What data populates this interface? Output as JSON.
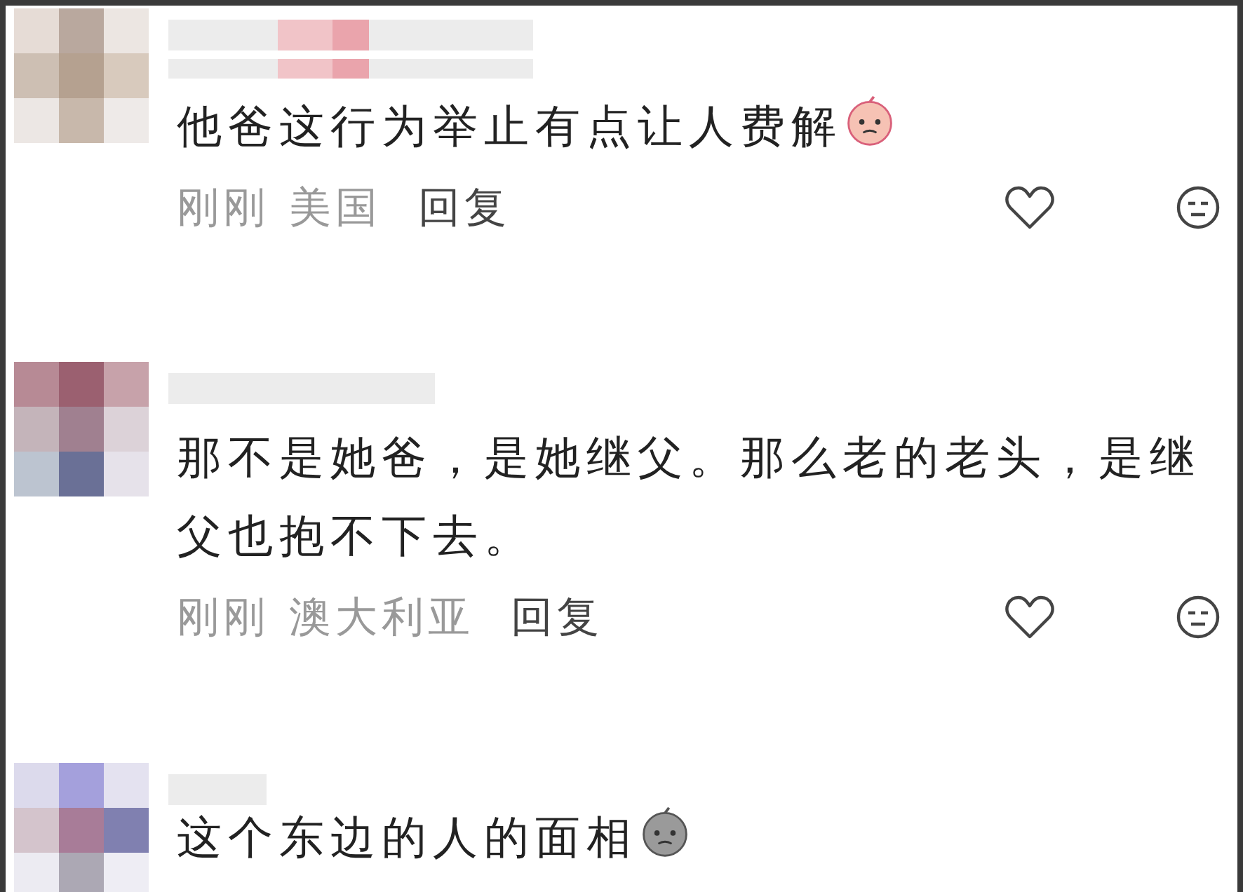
{
  "comments": [
    {
      "text": "他爸这行为举止有点让人费解",
      "time": "刚刚",
      "location": "美国",
      "reply": "回复"
    },
    {
      "text": "那不是她爸，是她继父。那么老的老头，是继父也抱不下去。",
      "time": "刚刚",
      "location": "澳大利亚",
      "reply": "回复"
    },
    {
      "text": "这个东边的人的面相"
    }
  ]
}
